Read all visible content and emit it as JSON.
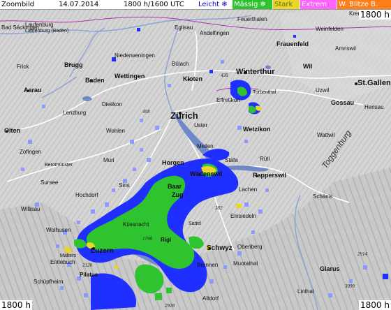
{
  "header": {
    "title": "Zoombild",
    "date": "14.07.2014",
    "time": "1800 h/1600 UTC"
  },
  "legend": [
    {
      "label": "Leicht",
      "icon": "snowflake-icon",
      "color": "#ffffff"
    },
    {
      "label": "Mässig",
      "icon": "snowflake-icon",
      "color": "#2fc42f"
    },
    {
      "label": "Stark",
      "icon": "",
      "color": "#e8d62a"
    },
    {
      "label": "Extrem",
      "icon": "",
      "color": "#ff62ff"
    },
    {
      "label": "W. Blitze",
      "icon": "",
      "color": "#ff7e1a"
    }
  ],
  "legend_extra": "B.",
  "time_labels": {
    "top_right": "1800 h",
    "bottom_left": "1800 h",
    "bottom_right": "1800 h"
  },
  "map": {
    "colors": {
      "terrain": "#d6d6d6",
      "lake": "#6f88c8",
      "precip_light": "#1f2fff",
      "precip_moderate": "#2fc42f",
      "precip_heavy": "#e8d62a",
      "precip_light2": "#8a9aff"
    },
    "places": [
      {
        "name": "Bad Säckingen"
      },
      {
        "name": "Laufenburg"
      },
      {
        "name": "Laufenburg (Baden)"
      },
      {
        "name": "Frick"
      },
      {
        "name": "Eglisau"
      },
      {
        "name": "Andelfingen"
      },
      {
        "name": "Feuerthalen"
      },
      {
        "name": "Frauenfeld"
      },
      {
        "name": "Weinfelden"
      },
      {
        "name": "Amriswil"
      },
      {
        "name": "Brugg"
      },
      {
        "name": "Niederweningen"
      },
      {
        "name": "Bülach"
      },
      {
        "name": "Wettingen"
      },
      {
        "name": "Baden"
      },
      {
        "name": "Kloten"
      },
      {
        "name": "Winterthur"
      },
      {
        "name": "Wil"
      },
      {
        "name": "St.Gallen"
      },
      {
        "name": "Aarau"
      },
      {
        "name": "Dietikon"
      },
      {
        "name": "Zürich"
      },
      {
        "name": "Effretikon"
      },
      {
        "name": "Turbenthal"
      },
      {
        "name": "Uzwil"
      },
      {
        "name": "Gossau"
      },
      {
        "name": "Lenzburg"
      },
      {
        "name": "Wohlen"
      },
      {
        "name": "Uster"
      },
      {
        "name": "Wetzikon"
      },
      {
        "name": "Olten"
      },
      {
        "name": "Zofingen"
      },
      {
        "name": "Meilen"
      },
      {
        "name": "Stäfa"
      },
      {
        "name": "Rüti"
      },
      {
        "name": "Horgen"
      },
      {
        "name": "Wädenswil"
      },
      {
        "name": "Rapperswil"
      },
      {
        "name": "Muri"
      },
      {
        "name": "Baar"
      },
      {
        "name": "Zug"
      },
      {
        "name": "Lachen"
      },
      {
        "name": "Einsiedeln"
      },
      {
        "name": "Sursee"
      },
      {
        "name": "Küssnacht"
      },
      {
        "name": "Luzern"
      },
      {
        "name": "Schwyz"
      },
      {
        "name": "Brunnen"
      },
      {
        "name": "Altdorf"
      },
      {
        "name": "Glarus"
      },
      {
        "name": "Schänis"
      },
      {
        "name": "Wolhusen"
      },
      {
        "name": "Entlebuch"
      },
      {
        "name": "Schüpfheim"
      },
      {
        "name": "Malters"
      },
      {
        "name": "Rigi"
      },
      {
        "name": "Pilatus"
      },
      {
        "name": "Muotathal"
      },
      {
        "name": "Linthal"
      },
      {
        "name": "Herisau"
      },
      {
        "name": "Toggenburg"
      },
      {
        "name": "Sattel"
      },
      {
        "name": "Oberiberg"
      },
      {
        "name": "Hochdorf"
      },
      {
        "name": "Beromünster"
      },
      {
        "name": "Willisau"
      },
      {
        "name": "Sins"
      },
      {
        "name": "Wattwil"
      },
      {
        "name": "Kreuzlingen"
      }
    ],
    "elevations": [
      "2120",
      "1798",
      "2914",
      "3099",
      "2928",
      "438",
      "382",
      "408"
    ]
  }
}
